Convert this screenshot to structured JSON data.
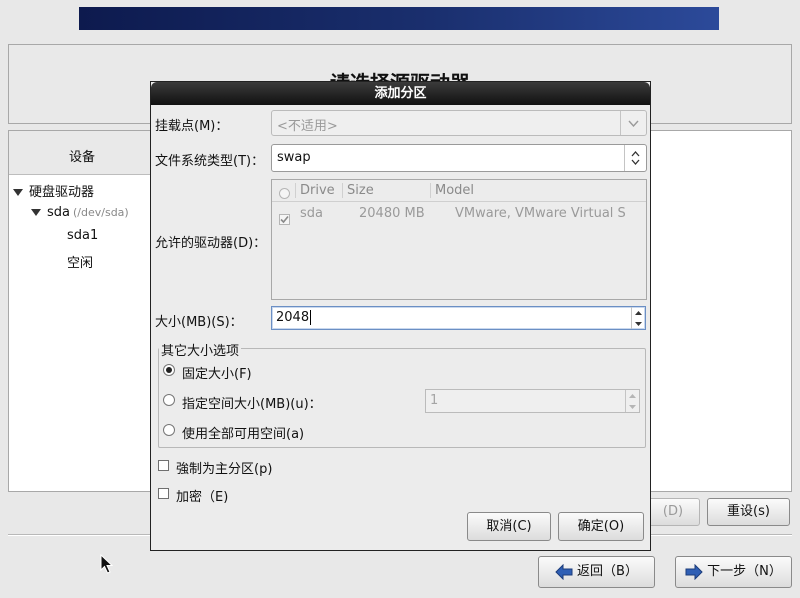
{
  "installer": {
    "heading": "请选择源驱动器",
    "column_header": "设备",
    "tree": {
      "group": "硬盘驱动器",
      "disk": "sda",
      "disk_path": "(/dev/sda)",
      "partitions": [
        "sda1",
        "空闲"
      ]
    },
    "buttons": {
      "delete_label": "(D)",
      "reset_label": "重设(s)",
      "back_label": "返回（B）",
      "next_label": "下一步（N）"
    }
  },
  "dialog": {
    "title": "添加分区",
    "mount_point": {
      "label": "挂载点(M)：",
      "value": "<不适用>"
    },
    "fs_type": {
      "label": "文件系统类型(T)：",
      "value": "swap"
    },
    "drives": {
      "label": "允许的驱动器(D)：",
      "headers": [
        "Drive",
        "Size",
        "Model"
      ],
      "rows": [
        {
          "drive": "sda",
          "size": "20480 MB",
          "model": "VMware, VMware Virtual S",
          "checked": true
        }
      ]
    },
    "size": {
      "label": "大小(MB)(S)：",
      "value": "2048"
    },
    "other_options": {
      "legend": "其它大小选项",
      "fixed": "固定大小(F)",
      "fill_to": "指定空间大小(MB)(u)：",
      "fill_to_value": "1",
      "fill_all": "使用全部可用空间(a)",
      "selected": "fixed"
    },
    "force_primary": "強制为主分区(p)",
    "encrypt": "加密（E)",
    "cancel_label": "取消(C)",
    "ok_label": "确定(O)"
  }
}
